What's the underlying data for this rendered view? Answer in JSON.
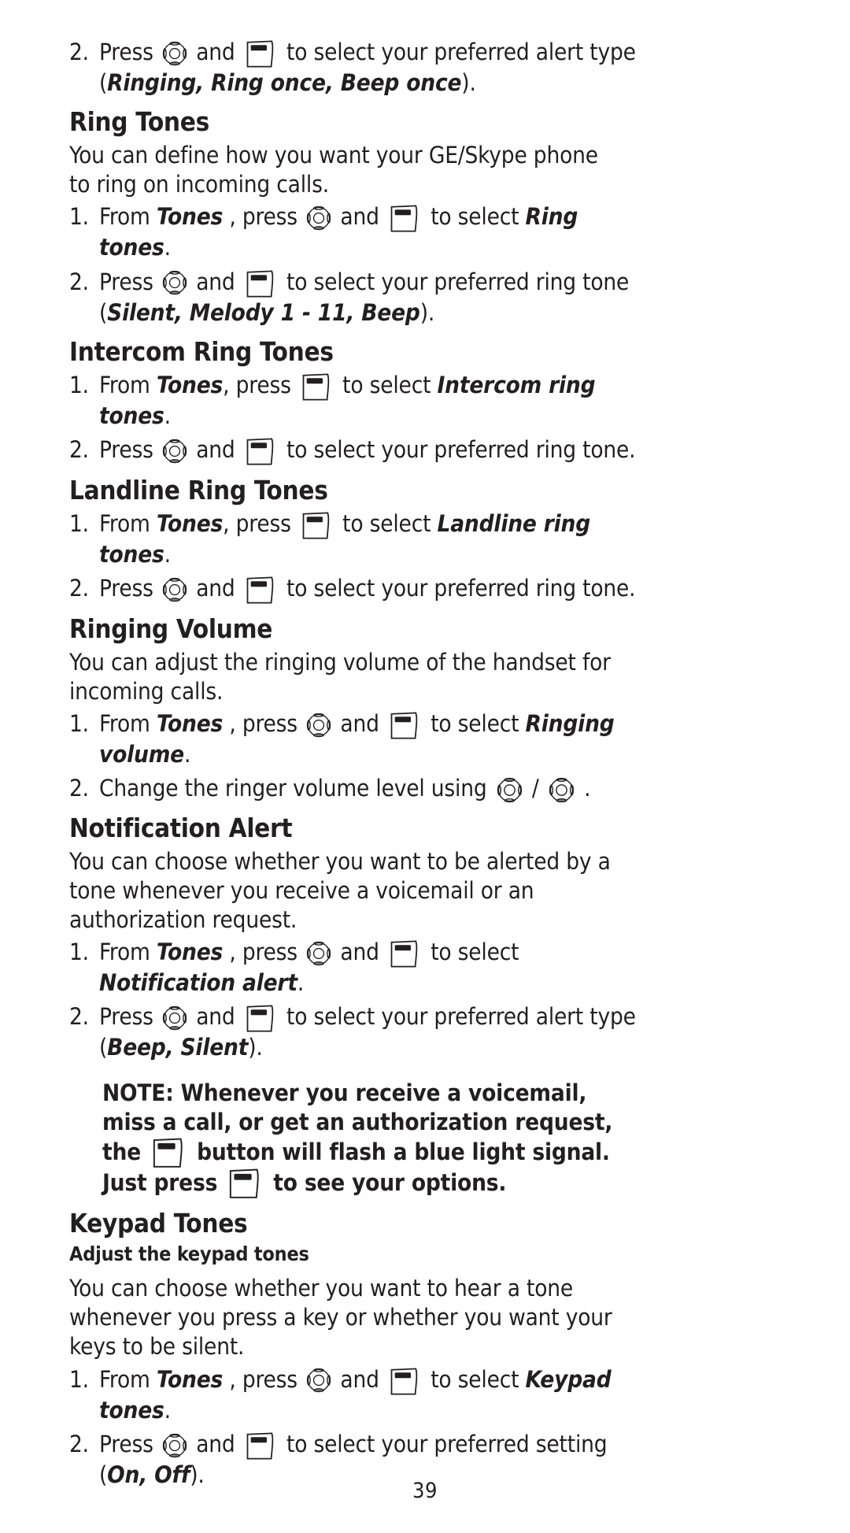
{
  "document": {
    "page_number": "39",
    "colors": {
      "text": "#231f20",
      "icon_outline": "#231f20",
      "icon_fill_gray": "#808285",
      "icon_fill_black": "#231f20",
      "background": "#ffffff"
    }
  },
  "icons": {
    "nav_up": "nav-pad-up-icon",
    "nav_down": "nav-pad-down-icon",
    "nav_select": "nav-pad-icon",
    "softkey": "softkey-button-icon"
  },
  "blocks": {
    "step_alert_type": {
      "num": "2.",
      "t1": "Press ",
      "t2": " and ",
      "t3": " to select your preferred alert type (",
      "em1": "Ringing, Ring once, Beep once",
      "t4": ")."
    },
    "ring_tones": {
      "heading": "Ring Tones",
      "intro": "You can define how you want your GE/Skype phone to ring on incoming calls.",
      "step1": {
        "num": "1.",
        "t1": "From ",
        "em1": "Tones",
        "t2": " , press ",
        "t3": " and ",
        "t4": " to select ",
        "em2": "Ring tones",
        "t5": "."
      },
      "step2": {
        "num": "2.",
        "t1": "Press ",
        "t2": " and ",
        "t3": " to select your preferred ring tone (",
        "em1": "Silent, Melody 1 - 11, Beep",
        "t4": ")."
      }
    },
    "intercom_ring_tones": {
      "heading": "Intercom Ring Tones",
      "step1": {
        "num": "1.",
        "t1": "From ",
        "em1": "Tones",
        "t2": ", press ",
        "t3": " to select ",
        "em2": "Intercom ring tones",
        "t4": "."
      },
      "step2": {
        "num": "2.",
        "t1": "Press ",
        "t2": " and ",
        "t3": " to select your preferred ring tone."
      }
    },
    "landline_ring_tones": {
      "heading": "Landline Ring Tones",
      "step1": {
        "num": "1.",
        "t1": "From ",
        "em1": "Tones",
        "t2": ", press ",
        "t3": " to select ",
        "em2": "Landline ring tones",
        "t4": "."
      },
      "step2": {
        "num": "2.",
        "t1": "Press ",
        "t2": " and ",
        "t3": " to select your preferred ring tone."
      }
    },
    "ringing_volume": {
      "heading": "Ringing Volume",
      "intro": "You can adjust the ringing volume of the handset for incoming calls.",
      "step1": {
        "num": "1.",
        "t1": "From ",
        "em1": "Tones",
        "t2": " , press ",
        "t3": " and ",
        "t4": " to select ",
        "em2": "Ringing volume",
        "t5": "."
      },
      "step2": {
        "num": "2.",
        "t1": "Change the ringer volume level using ",
        "t2": " / ",
        "t3": " ."
      }
    },
    "notification_alert": {
      "heading": "Notification Alert",
      "intro": "You can choose whether you want to be alerted by a tone whenever you receive a voicemail or an authorization request.",
      "step1": {
        "num": "1.",
        "t1": "From ",
        "em1": "Tones",
        "t2": " , press ",
        "t3": " and ",
        "t4": " to select ",
        "em2": "Notification alert",
        "t5": "."
      },
      "step2": {
        "num": "2.",
        "t1": "Press ",
        "t2": " and ",
        "t3": " to select your preferred alert type (",
        "em1": "Beep, Silent",
        "t4": ")."
      },
      "note": {
        "t1": "NOTE: Whenever you receive a voicemail, miss a call, or get an authorization request, the ",
        "t2": " button will flash a blue light signal. Just press ",
        "t3": " to see your options."
      }
    },
    "keypad_tones": {
      "heading": "Keypad Tones",
      "subheading": "Adjust the keypad tones",
      "intro": "You can choose whether you want to hear a tone whenever you press a key or whether you want your keys to be silent.",
      "step1": {
        "num": "1.",
        "t1": "From ",
        "em1": "Tones",
        "t2": " , press ",
        "t3": " and ",
        "t4": " to select ",
        "em2": "Keypad tones",
        "t5": "."
      },
      "step2": {
        "num": "2.",
        "t1": "Press ",
        "t2": " and ",
        "t3": " to select your preferred setting (",
        "em1": "On, Off",
        "t4": ")."
      }
    }
  }
}
